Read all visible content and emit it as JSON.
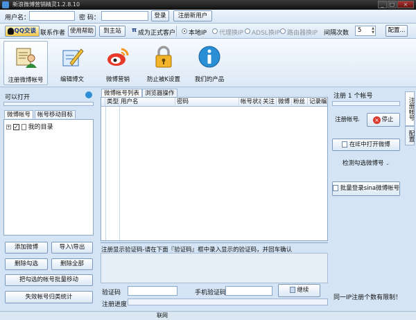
{
  "window": {
    "title": "新浪微博营销精灵1.2.8.10",
    "min": "_",
    "max": "□",
    "close": "×"
  },
  "login_bar": {
    "username_label": "用户名：",
    "username_value": "",
    "password_label": "密  码：",
    "password_value": "",
    "login_button": "登录",
    "register_button": "注册新用户"
  },
  "options_bar": {
    "qq_button": "QQ交谈",
    "contact_author": "联系作者",
    "help_button": "使用帮助",
    "home_button": "到主站",
    "pi_symbol": "π",
    "upgrade_link": "成为正式客户",
    "ip_options": [
      "本地IP",
      "代理换IP",
      "ADSL换IP",
      "路由器换IP"
    ],
    "ip_selected": "本地IP",
    "interval_label": "间隔次数",
    "interval_value": "5",
    "config_button": "配置..."
  },
  "toolbar": {
    "items": [
      {
        "label": "注册微博帐号",
        "icon": "register-user-icon"
      },
      {
        "label": "编辑博文",
        "icon": "edit-pen-icon"
      },
      {
        "label": "微博营销",
        "icon": "weibo-icon"
      },
      {
        "label": "防止被K设置",
        "icon": "lock-icon"
      },
      {
        "label": "我们的产品",
        "icon": "info-icon"
      }
    ]
  },
  "left_panel": {
    "can_open": "可以打开",
    "tabs": [
      "微博帐号",
      "帐号移动目标"
    ],
    "tree_root": "我的目录",
    "add_button": "添加微博",
    "import_export": "导入\\导出",
    "delete_checked": "删除勾选",
    "delete_all": "删除全部",
    "batch_move": "把勾选的帐号批量移动",
    "invalid_stats": "失效帐号归类统计"
  },
  "center_panel": {
    "tabs": [
      "微博帐号列表",
      "浏览器操作"
    ],
    "columns": [
      "类型",
      "用户名",
      "密码",
      "帐号状态",
      "关注",
      "微博",
      "粉丝",
      "记录编"
    ],
    "captcha_hint": "注册显示验证码-请在下面『验证码』框中录入显示的验证码，并回车确认",
    "captcha_label": "验证码",
    "captcha_value": "",
    "phone_code_label": "手机验证码",
    "phone_code_value": "",
    "continue_button": "继续",
    "progress_label": "注册进度",
    "progress": 0
  },
  "right_panel": {
    "registered": "注册 1 个帐号",
    "mode_select": "注册帐号",
    "stop_button": "停止",
    "open_ie_button": "在IE中打开微博",
    "check_select": "检测勾选微博号",
    "batch_login_button": "批量登录sina微博帐号",
    "ip_limit_note": "同一IP注册个数有限制！"
  },
  "side_tabs": [
    "注册帐号",
    "配置"
  ],
  "status_bar": {
    "network": "联网"
  },
  "colors": {
    "title_bg": "#1a1a1a",
    "panel_bg": "#d4e4f4",
    "border": "#8aa6c6",
    "stop_red": "#d93a2b"
  }
}
